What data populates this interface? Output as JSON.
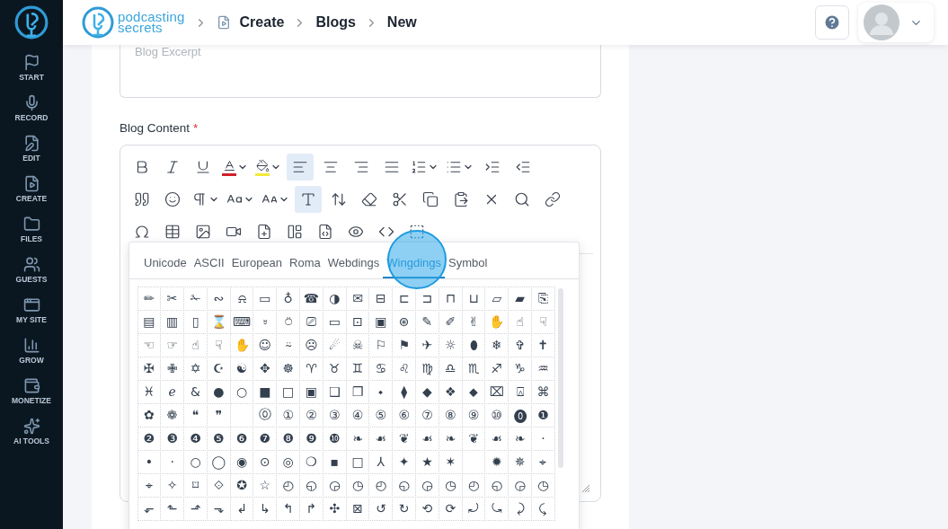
{
  "sidebar": {
    "items": [
      {
        "label": "START",
        "selected": false
      },
      {
        "label": "RECORD",
        "selected": false
      },
      {
        "label": "EDIT",
        "selected": false
      },
      {
        "label": "CREATE",
        "selected": false
      },
      {
        "label": "FILES",
        "selected": false
      },
      {
        "label": "GUESTS",
        "selected": false
      },
      {
        "label": "MY SITE",
        "selected": false
      },
      {
        "label": "GROW",
        "selected": false
      },
      {
        "label": "MONETIZE",
        "selected": false
      },
      {
        "label": "AI TOOLS",
        "selected": false
      }
    ]
  },
  "header": {
    "logo": [
      "podcasting",
      "secrets"
    ],
    "breadcrumb": [
      "Create",
      "Blogs",
      "New"
    ]
  },
  "form": {
    "excerpt": {
      "placeholder": "Blog Excerpt"
    },
    "content_label": "Blog Content",
    "required_mark": "*"
  },
  "toolbar": [
    [
      {
        "active": false,
        "menu": false
      },
      {
        "active": false,
        "menu": false
      },
      {
        "active": false,
        "menu": false
      },
      {
        "active": false,
        "menu": true
      },
      {
        "active": false,
        "menu": true
      },
      {
        "active": true,
        "menu": false
      },
      {
        "active": false,
        "menu": false
      },
      {
        "active": false,
        "menu": false
      },
      {
        "active": false,
        "menu": false
      },
      {
        "active": false,
        "menu": true
      },
      {
        "active": false,
        "menu": true
      },
      {
        "active": false,
        "menu": false
      },
      {
        "active": false,
        "menu": false
      }
    ],
    [
      {
        "active": false,
        "menu": false
      },
      {
        "active": false,
        "menu": false
      },
      {
        "active": false,
        "menu": true
      },
      {
        "active": false,
        "menu": true
      },
      {
        "active": false,
        "menu": true
      },
      {
        "active": true,
        "menu": false
      },
      {
        "active": false,
        "menu": false
      },
      {
        "active": false,
        "menu": false
      },
      {
        "active": false,
        "menu": false
      },
      {
        "active": false,
        "menu": false
      },
      {
        "active": false,
        "menu": false
      },
      {
        "active": false,
        "menu": false
      },
      {
        "active": false,
        "menu": false
      },
      {
        "active": false,
        "menu": false
      }
    ],
    [
      {
        "active": false,
        "menu": false
      },
      {
        "active": false,
        "menu": false
      },
      {
        "active": false,
        "menu": false
      },
      {
        "active": false,
        "menu": false
      },
      {
        "active": false,
        "menu": false
      },
      {
        "active": false,
        "menu": false
      },
      {
        "active": false,
        "menu": false
      },
      {
        "active": false,
        "menu": false
      },
      {
        "active": false,
        "menu": false
      },
      {
        "active": false,
        "menu": false
      }
    ]
  ],
  "charmap": {
    "tabs": [
      {
        "label": "Unicode",
        "selected": false
      },
      {
        "label": "ASCII",
        "selected": false
      },
      {
        "label": "European",
        "selected": false
      },
      {
        "label": "Roma",
        "selected": false
      },
      {
        "label": "Webdings",
        "selected": false
      },
      {
        "label": "Wingdings",
        "selected": true
      },
      {
        "label": "Symbol",
        "selected": false
      }
    ],
    "rows": [
      [
        "✏",
        "✂",
        "✁",
        "∾",
        "⍾",
        "▭",
        "♁",
        "☎",
        "◑",
        "✉",
        "⊟",
        "⊏",
        "⊐",
        "⊓",
        "⊔",
        "▱",
        "▰",
        "⎘"
      ],
      [
        "▤",
        "▥",
        "▯",
        "⌛",
        "⌨",
        "⍤",
        "⍥",
        "⎚",
        "▭",
        "⊡",
        "▣",
        "⊛",
        "✎",
        "✐",
        "✌",
        "✋",
        "☝",
        "☟"
      ],
      [
        "☜",
        "☞",
        "☝",
        "☟",
        "✋",
        "☺",
        "⍨",
        "☹",
        "☄",
        "☠",
        "⚐",
        "⚑",
        "✈",
        "☼",
        "⬮",
        "❄",
        "✞",
        "✝"
      ],
      [
        "✠",
        "✙",
        "✡",
        "☪",
        "☯",
        "✥",
        "☸",
        "♈",
        "♉",
        "♊",
        "♋",
        "♌",
        "♍",
        "♎",
        "♏",
        "♐",
        "♑",
        "♒"
      ],
      [
        "♓",
        "ℯ",
        "&",
        "●",
        "○",
        "■",
        "□",
        "▣",
        "❑",
        "❒",
        "⬩",
        "⧫",
        "◆",
        "❖",
        "⬥",
        "⌧",
        "⍓",
        "⌘"
      ],
      [
        "✿",
        "❁",
        "❝",
        "❞",
        null,
        "⓪",
        "①",
        "②",
        "③",
        "④",
        "⑤",
        "⑥",
        "⑦",
        "⑧",
        "⑨",
        "⑩",
        "⓿",
        "❶"
      ],
      [
        "❷",
        "❸",
        "❹",
        "❺",
        "❻",
        "❼",
        "❽",
        "❾",
        "❿",
        "❧",
        "☙",
        "❦",
        "☙",
        "❧",
        "❦",
        "☙",
        "❧",
        "·"
      ],
      [
        "•",
        "·",
        "○",
        "◯",
        "◉",
        "⊙",
        "◎",
        "❍",
        "▪",
        "□",
        "⅄",
        "✦",
        "★",
        "✶",
        null,
        "✹",
        "✵",
        "⌖"
      ],
      [
        "⌖",
        "✧",
        "⌑",
        "⟐",
        "✪",
        "☆",
        "◴",
        "◵",
        "◶",
        "◷",
        "◴",
        "◵",
        "◶",
        "◷",
        "◴",
        "◵",
        "◶",
        "◷"
      ],
      [
        "⬐",
        "⬑",
        "⬏",
        "⬎",
        "↲",
        "↳",
        "↰",
        "↱",
        "✣",
        "⊠",
        "↺",
        "↻",
        "⟲",
        "⟳",
        "⤾",
        "⤿",
        "⤸",
        "⤹"
      ]
    ]
  }
}
